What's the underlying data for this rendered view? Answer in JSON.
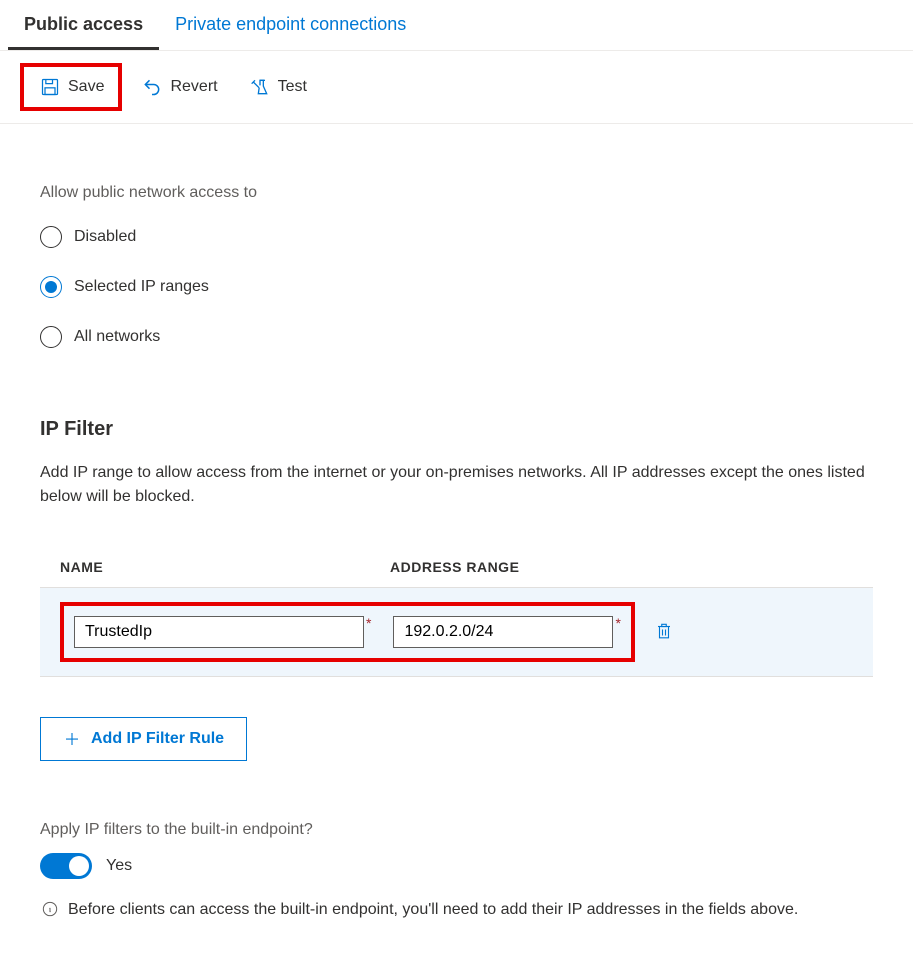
{
  "tabs": {
    "public": "Public access",
    "private": "Private endpoint connections"
  },
  "toolbar": {
    "save": "Save",
    "revert": "Revert",
    "test": "Test"
  },
  "access": {
    "label": "Allow public network access to",
    "options": {
      "disabled": "Disabled",
      "selected": "Selected IP ranges",
      "all": "All networks"
    }
  },
  "ipfilter": {
    "heading": "IP Filter",
    "description": "Add IP range to allow access from the internet or your on-premises networks. All IP addresses except the ones listed below will be blocked.",
    "columns": {
      "name": "NAME",
      "range": "ADDRESS RANGE"
    },
    "rows": [
      {
        "name": "TrustedIp",
        "range": "192.0.2.0/24"
      }
    ],
    "add_label": "Add IP Filter Rule"
  },
  "apply": {
    "label": "Apply IP filters to the built-in endpoint?",
    "value": "Yes",
    "info": "Before clients can access the built-in endpoint, you'll need to add their IP addresses in the fields above."
  }
}
